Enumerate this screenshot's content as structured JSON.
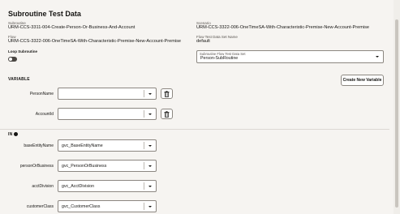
{
  "page": {
    "title": "Subroutine Test Data"
  },
  "info": {
    "subroutine_label": "Subroutine",
    "subroutine_value": "URM-CCS-3311-004-Create-Person-Or-Business-And-Account",
    "scenario_label": "Scenario",
    "scenario_value": "URM-CCS-3322-006-OneTimeSA-With-Characteristic-Premise-New-Account-Premise",
    "flow_label": "Flow",
    "flow_value": "URM-CCS-3322-006-OneTimeSA-With-Characteristic-Premise-New-Account-Premise",
    "flow_test_data_set_label": "Flow Test Data Set Name",
    "flow_test_data_set_value": "default",
    "loop_label": "Loop Subroutine",
    "subroutine_flow_set_label": "Subroutine Flow Test Data Set",
    "subroutine_flow_set_value": "Person-SubRoutine"
  },
  "variable": {
    "section_label": "VARIABLE",
    "new_button": "Create New Variable",
    "rows": [
      {
        "label": "PersonName",
        "value": ""
      },
      {
        "label": "AccountId",
        "value": ""
      }
    ]
  },
  "in": {
    "section_label": "IN",
    "rows": [
      {
        "label": "baseEntityName",
        "value": "gvc_BaseEntityName"
      },
      {
        "label": "personOrBusiness",
        "value": "gvc_PersonOrBusiness"
      },
      {
        "label": "acctDivision",
        "value": "gvc_AcctDivision"
      },
      {
        "label": "customerClass",
        "value": "gvc_CustomerClass"
      }
    ]
  },
  "icons": {
    "delete": "trash-icon",
    "dropdown": "chevron-down-icon",
    "info": "info-icon"
  }
}
